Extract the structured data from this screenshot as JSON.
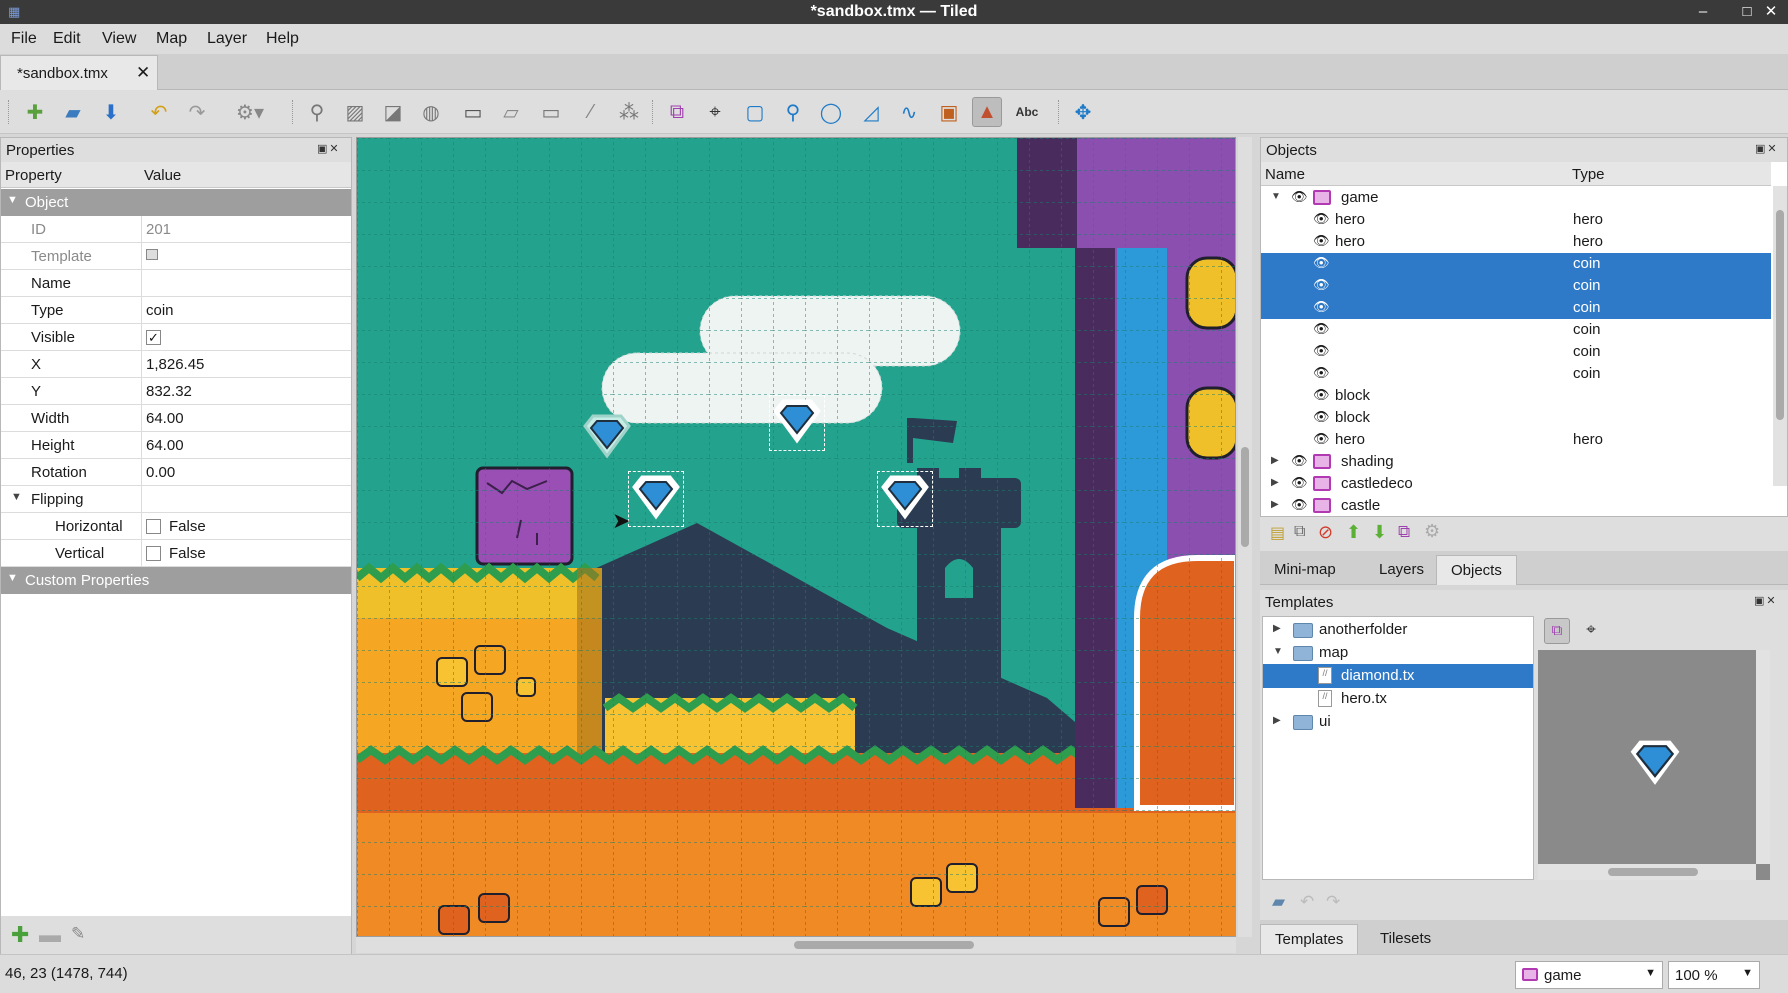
{
  "window": {
    "title": "*sandbox.tmx — Tiled"
  },
  "menu": [
    "File",
    "Edit",
    "View",
    "Map",
    "Layer",
    "Help"
  ],
  "doc_tab": {
    "label": "*sandbox.tmx"
  },
  "properties": {
    "panel_title": "Properties",
    "col_property": "Property",
    "col_value": "Value",
    "group_object": "Object",
    "rows": {
      "id": {
        "label": "ID",
        "value": "201"
      },
      "template": {
        "label": "Template"
      },
      "name": {
        "label": "Name",
        "value": ""
      },
      "type": {
        "label": "Type",
        "value": "coin"
      },
      "visible": {
        "label": "Visible",
        "checked": true
      },
      "x": {
        "label": "X",
        "value": "1,826.45"
      },
      "y": {
        "label": "Y",
        "value": "832.32"
      },
      "width": {
        "label": "Width",
        "value": "64.00"
      },
      "height": {
        "label": "Height",
        "value": "64.00"
      },
      "rotation": {
        "label": "Rotation",
        "value": "0.00"
      }
    },
    "group_flipping": "Flipping",
    "horizontal": {
      "label": "Horizontal",
      "value": "False"
    },
    "vertical": {
      "label": "Vertical",
      "value": "False"
    },
    "group_custom": "Custom Properties"
  },
  "objects": {
    "panel_title": "Objects",
    "col_name": "Name",
    "col_type": "Type",
    "tree": [
      {
        "name": "game",
        "type": "",
        "kind": "layer",
        "expanded": true
      },
      {
        "name": "hero",
        "type": "hero",
        "kind": "object"
      },
      {
        "name": "hero",
        "type": "hero",
        "kind": "object"
      },
      {
        "name": "",
        "type": "coin",
        "kind": "object",
        "selected": true
      },
      {
        "name": "",
        "type": "coin",
        "kind": "object",
        "selected": true
      },
      {
        "name": "",
        "type": "coin",
        "kind": "object",
        "selected": true
      },
      {
        "name": "",
        "type": "coin",
        "kind": "object"
      },
      {
        "name": "",
        "type": "coin",
        "kind": "object"
      },
      {
        "name": "",
        "type": "coin",
        "kind": "object"
      },
      {
        "name": "block",
        "type": "",
        "kind": "object"
      },
      {
        "name": "block",
        "type": "",
        "kind": "object"
      },
      {
        "name": "hero",
        "type": "hero",
        "kind": "object"
      },
      {
        "name": "shading",
        "type": "",
        "kind": "layer",
        "expanded": false
      },
      {
        "name": "castledeco",
        "type": "",
        "kind": "layer",
        "expanded": false
      },
      {
        "name": "castle",
        "type": "",
        "kind": "layer",
        "expanded": false
      }
    ]
  },
  "right_tabs_top": [
    "Mini-map",
    "Layers",
    "Objects"
  ],
  "templates": {
    "panel_title": "Templates",
    "tree": [
      {
        "name": "anotherfolder",
        "kind": "folder",
        "expanded": false
      },
      {
        "name": "map",
        "kind": "folder",
        "expanded": true
      },
      {
        "name": "diamond.tx",
        "kind": "file",
        "selected": true
      },
      {
        "name": "hero.tx",
        "kind": "file"
      },
      {
        "name": "ui",
        "kind": "folder",
        "expanded": false
      }
    ]
  },
  "right_tabs_bottom": [
    "Templates",
    "Tilesets"
  ],
  "status": {
    "coords": "46, 23 (1478, 744)",
    "layer_combo": "game",
    "zoom_combo": "100 %"
  },
  "colors": {
    "selection": "#2f7ac8",
    "map_sky": "#23a38d",
    "brick_purple": "#8b4fb0",
    "brick_blue": "#2c9ad8",
    "ground_orange": "#f0a030",
    "dark_silhouette": "#2a3b52"
  }
}
